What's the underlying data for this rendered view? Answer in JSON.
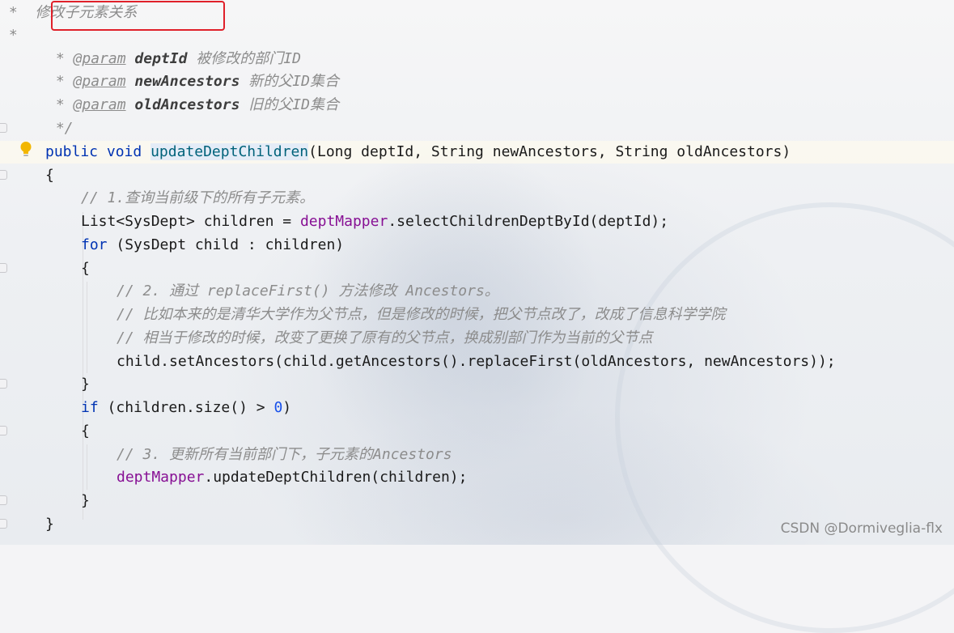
{
  "code_lines": {
    "l1": {
      "text": " *  修改子元素关系"
    },
    "l2": {
      "text": " *"
    },
    "l3": {
      "star": " * ",
      "tag": "@param",
      "name": "deptId",
      "desc": "被修改的部门ID"
    },
    "l4": {
      "star": " * ",
      "tag": "@param",
      "name": "newAncestors",
      "desc": "新的父ID集合"
    },
    "l5": {
      "star": " * ",
      "tag": "@param",
      "name": "oldAncestors",
      "desc": "旧的父ID集合"
    },
    "l6": {
      "text": " */"
    },
    "l7": {
      "kw_public": "public",
      "kw_void": "void",
      "method": "updateDeptChildren",
      "params": "(Long deptId, String newAncestors, String oldAncestors)"
    },
    "l8": {
      "text": "{"
    },
    "l9": {
      "comment": "// 1.查询当前级下的所有子元素。"
    },
    "l10": {
      "pre": "List<SysDept> children = ",
      "field": "deptMapper",
      "post": ".selectChildrenDeptById(deptId);"
    },
    "l11": {
      "kw": "for",
      "rest": " (SysDept child : children)"
    },
    "l12": {
      "text": "{"
    },
    "l13": {
      "comment": "// 2. 通过 replaceFirst() 方法修改 Ancestors。"
    },
    "l14": {
      "comment": "// 比如本来的是清华大学作为父节点，但是修改的时候，把父节点改了，改成了信息科学学院"
    },
    "l15": {
      "comment": "// 相当于修改的时候，改变了更换了原有的父节点，换成别部门作为当前的父节点"
    },
    "l16": {
      "text": "child.setAncestors(child.getAncestors().replaceFirst(oldAncestors, newAncestors));"
    },
    "l17": {
      "text": "}"
    },
    "l18": {
      "kw": "if",
      "pre": " (children.size() > ",
      "num": "0",
      "post": ")"
    },
    "l19": {
      "text": "{"
    },
    "l20": {
      "comment": "// 3. 更新所有当前部门下，子元素的Ancestors"
    },
    "l21": {
      "field": "deptMapper",
      "post": ".updateDeptChildren(children);"
    },
    "l22": {
      "text": "}"
    },
    "l23": {
      "text": "}"
    }
  },
  "watermark": "CSDN @Dormiveglia-flx",
  "colors": {
    "keyword": "#0033b3",
    "method_decl": "#00627a",
    "comment": "#8c8c8c",
    "field": "#871094",
    "number": "#1750eb",
    "highlight_box": "#e0202a"
  },
  "icons": {
    "intention_bulb": "lightbulb-icon"
  }
}
